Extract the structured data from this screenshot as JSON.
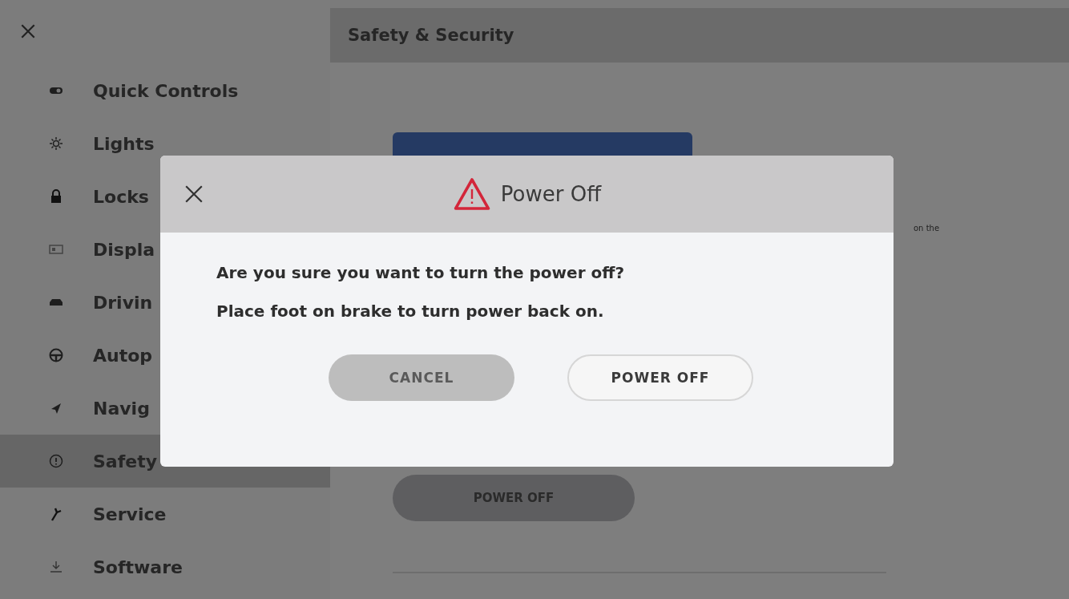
{
  "sidebar": {
    "items": [
      {
        "label": "Quick Controls",
        "selected": false
      },
      {
        "label": "Lights",
        "selected": false
      },
      {
        "label": "Locks",
        "selected": false
      },
      {
        "label": "Displa",
        "selected": false
      },
      {
        "label": "Drivin",
        "selected": false
      },
      {
        "label": "Autop",
        "selected": false
      },
      {
        "label": "Navig",
        "selected": false
      },
      {
        "label": "Safety",
        "selected": true
      },
      {
        "label": "Service",
        "selected": false
      },
      {
        "label": "Software",
        "selected": false
      }
    ]
  },
  "page": {
    "title": "Safety & Security",
    "text_fragment": "on the",
    "button": "POWER OFF"
  },
  "dialog": {
    "title": "Power Off",
    "lines": [
      "Are you sure you want to turn the power off?",
      "Place foot on brake to turn power back on."
    ],
    "buttons": [
      {
        "label": "CANCEL",
        "kind": "secondary"
      },
      {
        "label": "POWER OFF",
        "kind": "primary"
      }
    ]
  }
}
